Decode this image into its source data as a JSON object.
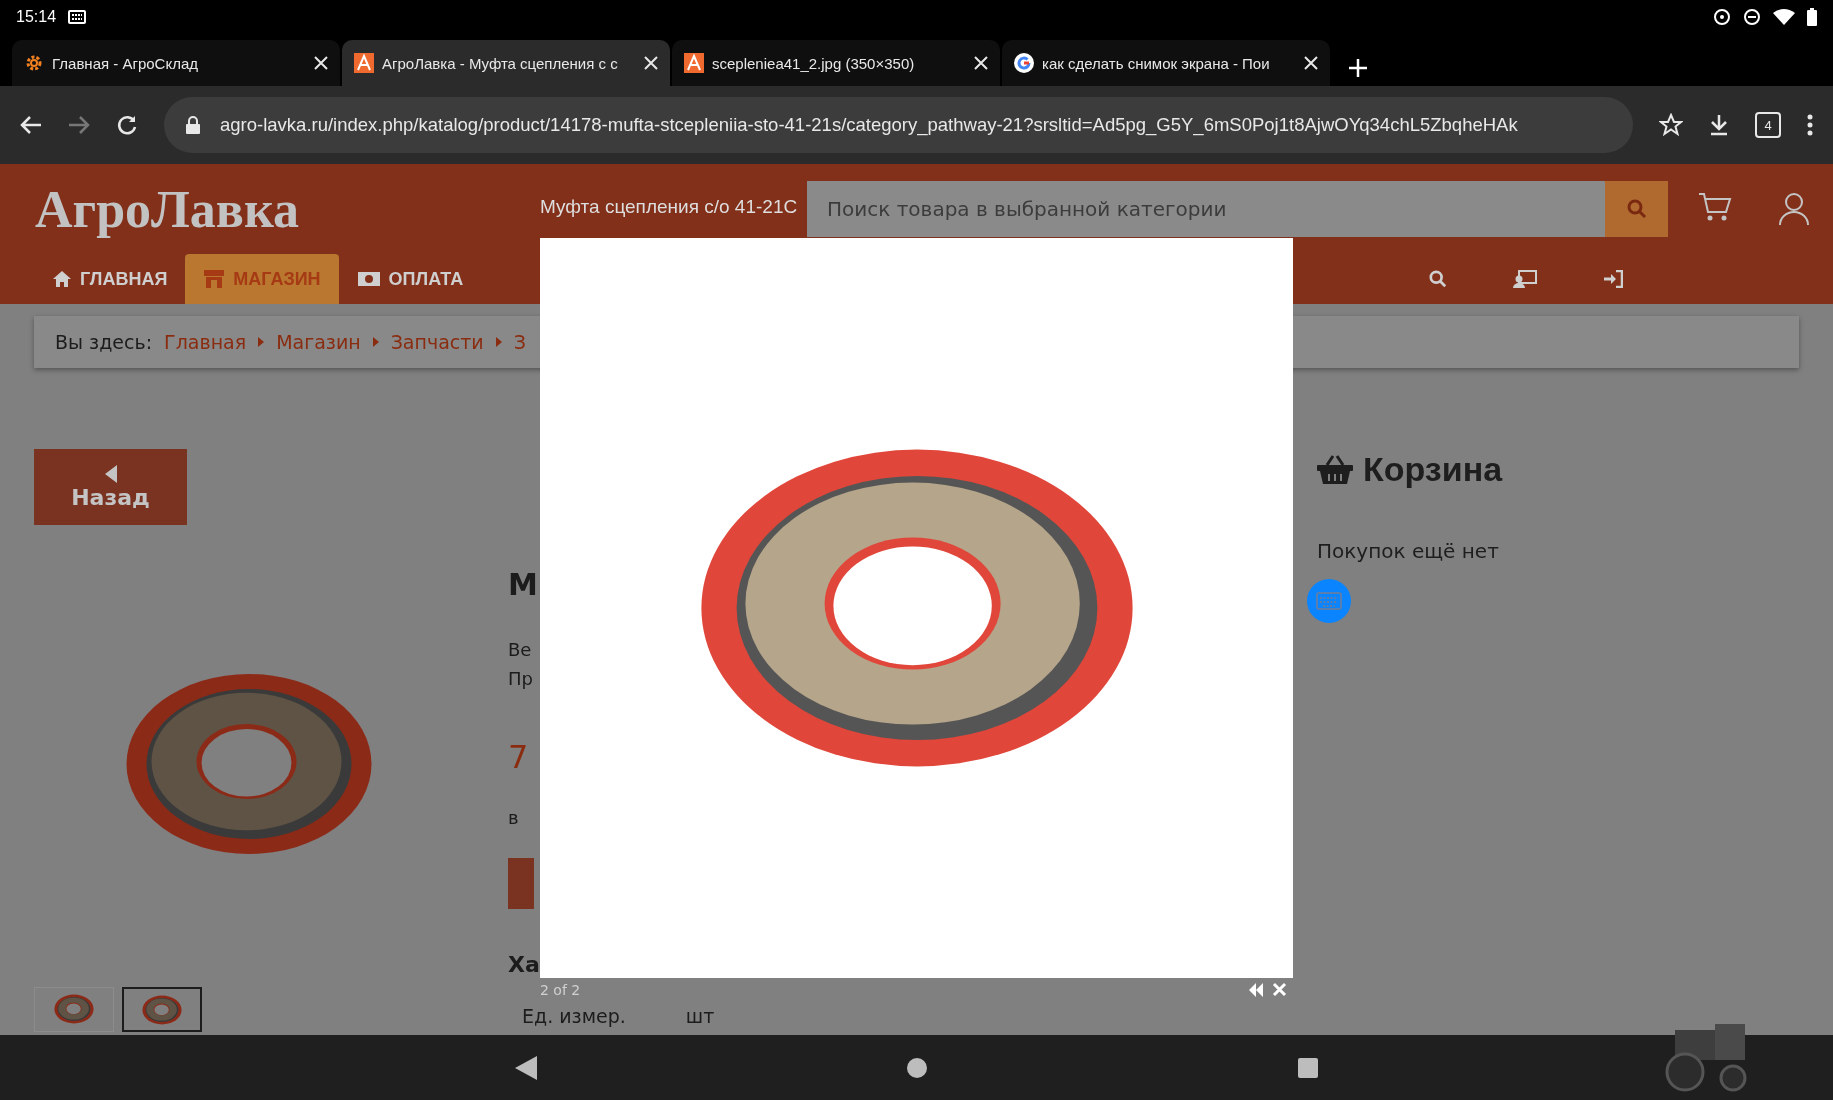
{
  "status_bar": {
    "time": "15:14"
  },
  "browser_tabs": [
    {
      "title": "Главная - АгроСклад",
      "selected": false
    },
    {
      "title": "АгроЛавка - Муфта сцепления с с",
      "selected": true
    },
    {
      "title": "scepleniea41_2.jpg (350×350)",
      "selected": false
    },
    {
      "title": "как сделать снимок экрана - Пои",
      "selected": false
    }
  ],
  "address_bar": {
    "url": "agro-lavka.ru/index.php/katalog/product/14178-mufta-stcepleniia-sto-41-21s/category_pathway-21?srsltid=Ad5pg_G5Y_6mS0Poj1t8AjwOYq34chL5ZbqheHAk",
    "tab_count": "4"
  },
  "site_header": {
    "logo": "АгроЛавка",
    "search": {
      "placeholder": "Поиск товара в выбранной категории"
    },
    "nav": [
      {
        "label": "ГЛАВНАЯ",
        "selected": false
      },
      {
        "label": "МАГАЗИН",
        "selected": true
      },
      {
        "label": "ОПЛАТА",
        "selected": false
      }
    ]
  },
  "breadcrumb": {
    "label": "Вы здесь:",
    "items": [
      "Главная",
      "Магазин",
      "Запчасти",
      "З"
    ]
  },
  "back_button": "Назад",
  "thumbnails": [
    {
      "selected": false
    },
    {
      "selected": true
    }
  ],
  "product": {
    "heading": "М",
    "lines": [
      "Ве",
      "Пр"
    ],
    "price": "7",
    "stock": "в",
    "section": "Ха",
    "spec": {
      "label": "Ед. измер.",
      "value": "шт"
    }
  },
  "cart": {
    "title": "Корзина",
    "empty": "Покупок ещё нет"
  },
  "lightbox": {
    "title": "Муфта сцепления с/о 41-21С",
    "counter": "2 of 2"
  }
}
